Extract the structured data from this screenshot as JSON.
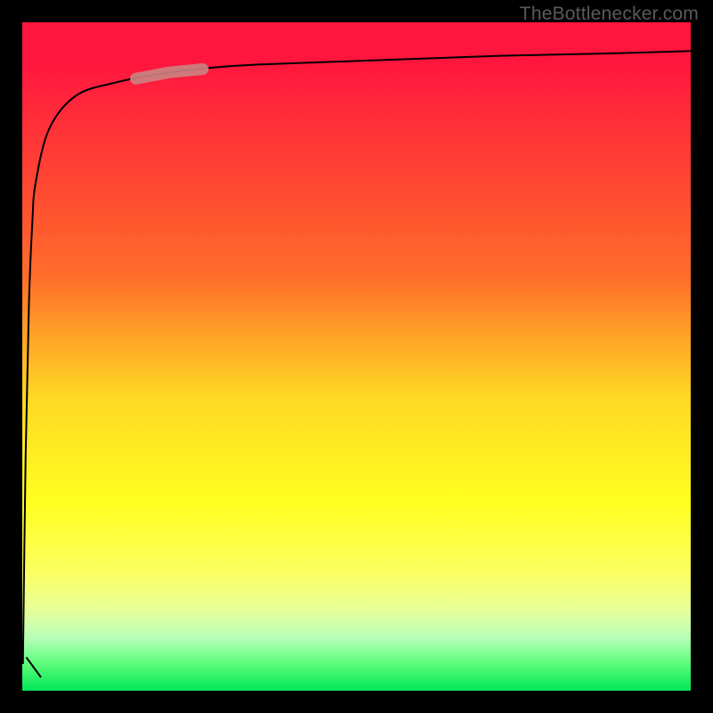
{
  "attribution": "TheBottlenecker.com",
  "colors": {
    "frame": "#000000",
    "curve": "#000000",
    "highlight": "#cb8383",
    "gradient_top": "#ff163e",
    "gradient_bottom": "#00e659",
    "attribution_text": "#5a5a5a"
  },
  "chart_data": {
    "type": "line",
    "title": "",
    "xlabel": "",
    "ylabel": "",
    "xlim": [
      0,
      100
    ],
    "ylim": [
      0,
      100
    ],
    "series": [
      {
        "name": "bottleneck-curve",
        "x": [
          0.1,
          0.5,
          1.0,
          1.5,
          2.0,
          4.0,
          8.0,
          14.0,
          22.0,
          32.0,
          44.0,
          58.0,
          72.0,
          86.0,
          100.0
        ],
        "y": [
          4.0,
          35.0,
          58.0,
          70.0,
          76.0,
          84.0,
          89.0,
          91.0,
          92.5,
          93.5,
          94.0,
          94.5,
          95.0,
          95.3,
          95.7
        ]
      }
    ],
    "highlight": {
      "x_range": [
        17.0,
        27.0
      ],
      "description": "emphasized segment on curve"
    },
    "background_gradient": {
      "orientation": "vertical",
      "stops": [
        {
          "pos": 0.0,
          "color": "#ff163e"
        },
        {
          "pos": 0.38,
          "color": "#ff6d2a"
        },
        {
          "pos": 0.56,
          "color": "#ffd824"
        },
        {
          "pos": 0.72,
          "color": "#ffff20"
        },
        {
          "pos": 0.88,
          "color": "#e6ff9a"
        },
        {
          "pos": 1.0,
          "color": "#00e659"
        }
      ]
    }
  }
}
